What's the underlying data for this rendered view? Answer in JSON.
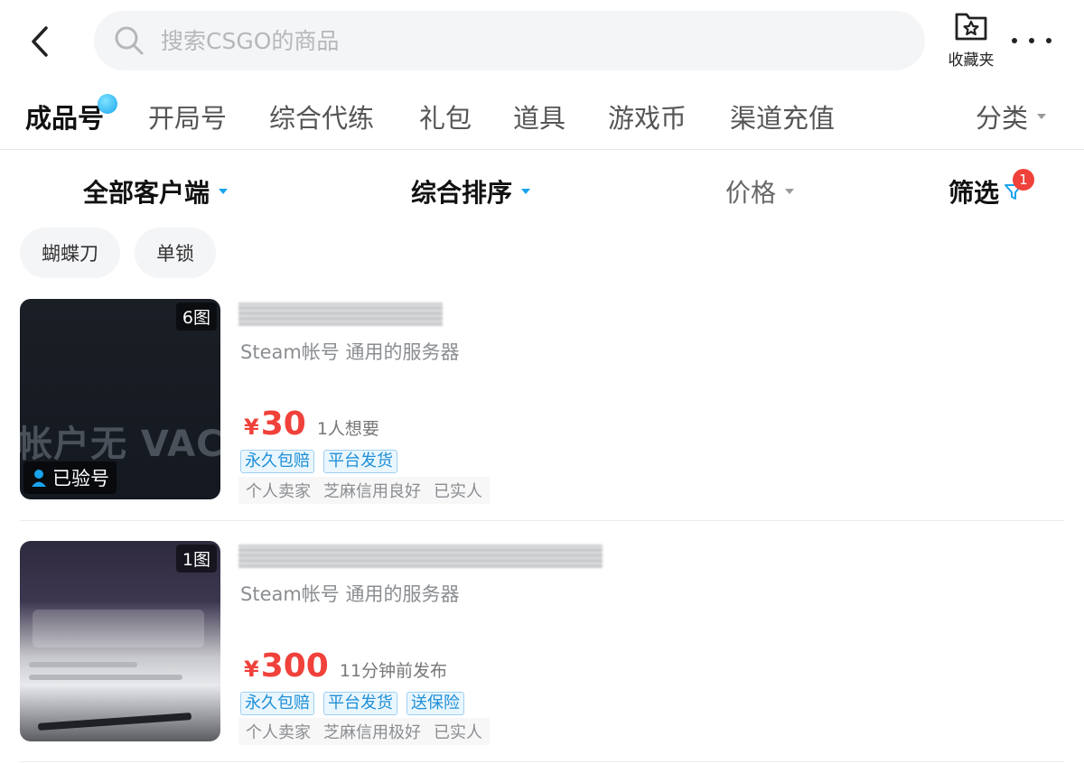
{
  "header": {
    "back_label": "",
    "search_placeholder": "搜索CSGO的商品",
    "favorites_label": "收藏夹"
  },
  "tabs": [
    {
      "label": "成品号",
      "active": true
    },
    {
      "label": "开局号"
    },
    {
      "label": "综合代练"
    },
    {
      "label": "礼包"
    },
    {
      "label": "道具"
    },
    {
      "label": "游戏币"
    },
    {
      "label": "渠道充值"
    }
  ],
  "tab_more_label": "分类",
  "sort": {
    "client": "全部客户端",
    "ranking": "综合排序",
    "price": "价格",
    "filter": "筛选",
    "filter_badge": "1"
  },
  "chips": [
    "蝴蝶刀",
    "单锁"
  ],
  "listings": [
    {
      "image_count": "6图",
      "thumb_text": "帐户无 VAC",
      "verified_label": "已验号",
      "subtitle": "Steam帐号 通用的服务器",
      "currency": "¥",
      "price": "30",
      "meta": "1人想要",
      "tags": [
        "永久包赔",
        "平台发货"
      ],
      "seller": [
        "个人卖家",
        "芝麻信用良好",
        "已实人"
      ]
    },
    {
      "image_count": "1图",
      "subtitle": "Steam帐号 通用的服务器",
      "currency": "¥",
      "price": "300",
      "meta": "11分钟前发布",
      "tags": [
        "永久包赔",
        "平台发货",
        "送保险"
      ],
      "seller": [
        "个人卖家",
        "芝麻信用极好",
        "已实人"
      ]
    }
  ],
  "colors": {
    "accent": "#19a3ee",
    "price": "#f0413a",
    "tag_text": "#1e8fd8"
  }
}
